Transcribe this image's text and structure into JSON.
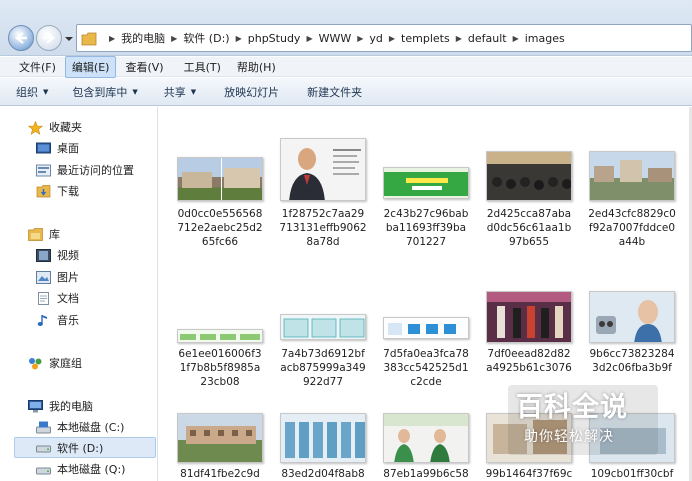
{
  "address": {
    "segments": [
      "我的电脑",
      "软件 (D:)",
      "phpStudy",
      "WWW",
      "yd",
      "templets",
      "default",
      "images"
    ]
  },
  "menubar": {
    "items": [
      {
        "label": "文件(F)"
      },
      {
        "label": "编辑(E)"
      },
      {
        "label": "查看(V)"
      },
      {
        "label": "工具(T)"
      },
      {
        "label": "帮助(H)"
      }
    ]
  },
  "toolbar": {
    "organize": "组织",
    "include": "包含到库中",
    "share": "共享",
    "slideshow": "放映幻灯片",
    "new_folder": "新建文件夹"
  },
  "nav": {
    "favorites": "收藏夹",
    "desktop": "桌面",
    "recent": "最近访问的位置",
    "downloads": "下载",
    "libraries": "库",
    "videos": "视频",
    "pictures": "图片",
    "documents": "文档",
    "music": "音乐",
    "homegroup": "家庭组",
    "computer": "我的电脑",
    "drive_c": "本地磁盘 (C:)",
    "drive_d": "软件 (D:)",
    "drive_q": "本地磁盘 (Q:)"
  },
  "files": [
    {
      "line1": "0d0cc0e556568",
      "line2": "712e2aebc25d2",
      "line3": "65fc66"
    },
    {
      "line1": "1f28752c7aa29",
      "line2": "713131effb9062",
      "line3": "8a78d"
    },
    {
      "line1": "2c43b27c96bab",
      "line2": "ba11693ff39ba",
      "line3": "701227"
    },
    {
      "line1": "2d425cca87aba",
      "line2": "d0dc56c61aa1b",
      "line3": "97b655"
    },
    {
      "line1": "2ed43cfc8829c0",
      "line2": "f92a7007fddce0",
      "line3": "a44b"
    },
    {
      "line1": "6e1ee016006f3",
      "line2": "1f7b8b5f8985a",
      "line3": "23cb08"
    },
    {
      "line1": "7a4b73d6912bf",
      "line2": "acb875999a349",
      "line3": "922d77"
    },
    {
      "line1": "7d5fa0ea3fca78",
      "line2": "383cc542525d1",
      "line3": "c2cde"
    },
    {
      "line1": "7df0eead82d82",
      "line2": "a4925b61c3076",
      "line3": ""
    },
    {
      "line1": "9b6cc73823284",
      "line2": "3d2c06fba3b9f",
      "line3": ""
    },
    {
      "line1": "81df41fbe2c9d",
      "line2": "",
      "line3": ""
    },
    {
      "line1": "83ed2d04f8ab8",
      "line2": "",
      "line3": ""
    },
    {
      "line1": "87eb1a99b6c58",
      "line2": "",
      "line3": ""
    },
    {
      "line1": "99b1464f37f69c",
      "line2": "",
      "line3": ""
    },
    {
      "line1": "109cb01ff30cbf",
      "line2": "",
      "line3": ""
    }
  ],
  "watermark": {
    "title": "百科全说",
    "subtitle": "助你轻松解决"
  },
  "colors": {
    "accent": "#cde2f8",
    "selection": "#dde9f6",
    "folder": "#e8b84a"
  }
}
